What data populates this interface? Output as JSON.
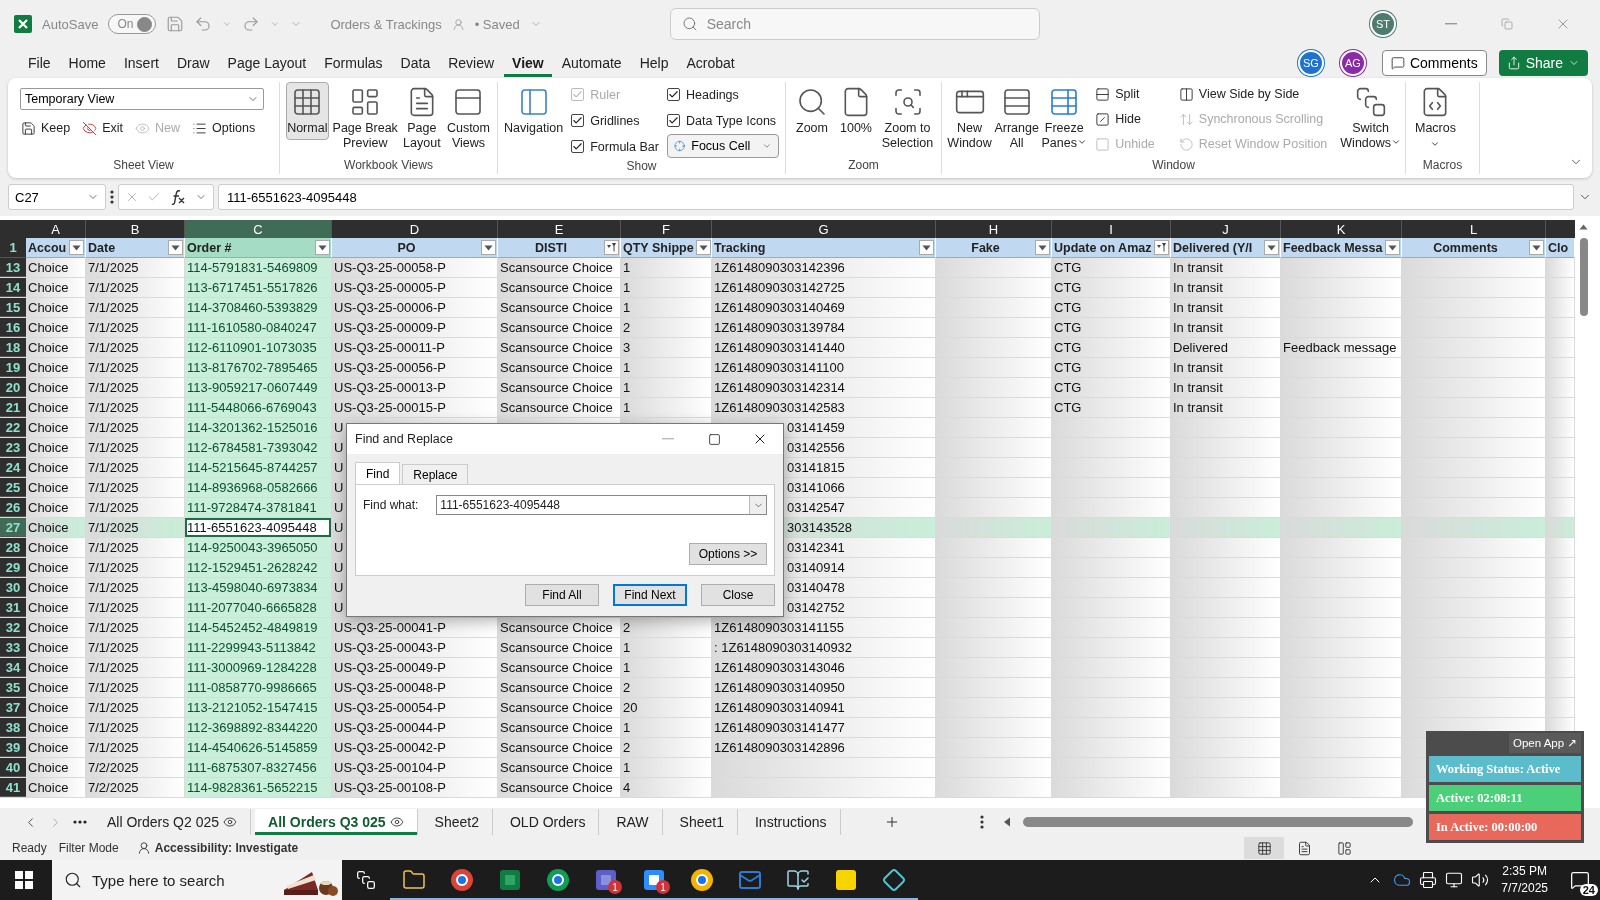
{
  "title_bar": {
    "autosave_label": "AutoSave",
    "autosave": {
      "on": true,
      "label": "On"
    },
    "document": "Orders & Trackings",
    "save_state": "• Saved",
    "search": {
      "placeholder": "Search"
    },
    "user": "ST"
  },
  "menu": {
    "tabs": [
      {
        "label": "File",
        "selected": false
      },
      {
        "label": "Home",
        "selected": false
      },
      {
        "label": "Insert",
        "selected": false
      },
      {
        "label": "Draw",
        "selected": false
      },
      {
        "label": "Page Layout",
        "selected": false
      },
      {
        "label": "Formulas",
        "selected": false
      },
      {
        "label": "Data",
        "selected": false
      },
      {
        "label": "Review",
        "selected": false
      },
      {
        "label": "View",
        "selected": true
      },
      {
        "label": "Automate",
        "selected": false
      },
      {
        "label": "Help",
        "selected": false
      },
      {
        "label": "Acrobat",
        "selected": false
      }
    ],
    "collaborators": [
      {
        "initials": "SG",
        "color": "#1e73d2"
      },
      {
        "initials": "AG",
        "color": "#8a2aa8"
      }
    ],
    "comments": "Comments",
    "share": "Share"
  },
  "ribbon": {
    "sheet_view": {
      "label": "Sheet View",
      "view": "Temporary View",
      "buttons": [
        {
          "label": "Keep",
          "disabled": false
        },
        {
          "label": "Exit",
          "disabled": false
        },
        {
          "label": "New",
          "disabled": true
        },
        {
          "label": "Options",
          "disabled": false
        }
      ]
    },
    "workbook_views": {
      "label": "Workbook Views",
      "items": [
        {
          "lines": [
            "Normal"
          ],
          "selected": true
        },
        {
          "lines": [
            "Page Break",
            "Preview"
          ],
          "selected": false
        },
        {
          "lines": [
            "Page",
            "Layout"
          ],
          "selected": false
        },
        {
          "lines": [
            "Custom",
            "Views"
          ],
          "selected": false
        }
      ]
    },
    "show": {
      "label": "Show",
      "navigation": "Navigation",
      "checks": [
        {
          "label": "Ruler",
          "checked": true,
          "disabled": true
        },
        {
          "label": "Gridlines",
          "checked": true,
          "disabled": false
        },
        {
          "label": "Formula Bar",
          "checked": true,
          "disabled": false
        },
        {
          "label": "Headings",
          "checked": true,
          "disabled": false
        },
        {
          "label": "Data Type Icons",
          "checked": true,
          "disabled": false
        }
      ],
      "focus_cell": "Focus Cell"
    },
    "zoom": {
      "label": "Zoom",
      "items": [
        {
          "lines": [
            "Zoom"
          ]
        },
        {
          "lines": [
            "100%"
          ]
        },
        {
          "lines": [
            "Zoom to",
            "Selection"
          ]
        }
      ]
    },
    "window": {
      "label": "Window",
      "large": [
        {
          "lines": [
            "New",
            "Window"
          ],
          "menu": false
        },
        {
          "lines": [
            "Arrange",
            "All"
          ],
          "menu": false
        },
        {
          "lines": [
            "Freeze",
            "Panes"
          ],
          "menu": true
        }
      ],
      "small": [
        {
          "label": "Split",
          "disabled": false
        },
        {
          "label": "Hide",
          "disabled": false
        },
        {
          "label": "Unhide",
          "disabled": true
        },
        {
          "label": "View Side by Side",
          "disabled": false
        },
        {
          "label": "Synchronous Scrolling",
          "disabled": true
        },
        {
          "label": "Reset Window Position",
          "disabled": true
        }
      ],
      "switch": {
        "lines": [
          "Switch",
          "Windows"
        ],
        "menu": true
      }
    },
    "macros": {
      "label": "Macros",
      "item": {
        "lines": [
          "Macros"
        ],
        "menu": true
      }
    }
  },
  "formula_bar": {
    "name_box": "C27",
    "value": "111-6551623-4095448"
  },
  "sheet": {
    "columns": [
      {
        "letter": "A",
        "selected": false
      },
      {
        "letter": "B",
        "selected": false
      },
      {
        "letter": "C",
        "selected": true
      },
      {
        "letter": "D",
        "selected": false
      },
      {
        "letter": "E",
        "selected": false
      },
      {
        "letter": "F",
        "selected": false
      },
      {
        "letter": "G",
        "selected": false
      },
      {
        "letter": "H",
        "selected": false
      },
      {
        "letter": "I",
        "selected": false
      },
      {
        "letter": "J",
        "selected": false
      },
      {
        "letter": "K",
        "selected": false
      },
      {
        "letter": "L",
        "selected": false
      }
    ],
    "header_row": "1",
    "headers": [
      {
        "label": "Accou",
        "filtered": false
      },
      {
        "label": "Date",
        "filtered": false
      },
      {
        "label": "Order #",
        "filtered": false
      },
      {
        "label": "PO",
        "filtered": false
      },
      {
        "label": "DISTI",
        "filtered": true
      },
      {
        "label": "QTY Shippe",
        "filtered": false
      },
      {
        "label": "Tracking",
        "filtered": false
      },
      {
        "label": "Fake",
        "filtered": false
      },
      {
        "label": "Update on Amaz",
        "filtered": true
      },
      {
        "label": "Delivered (Y/I",
        "filtered": false
      },
      {
        "label": "Feedback Messa",
        "filtered": false
      },
      {
        "label": "Comments",
        "filtered": false
      },
      {
        "label": "Clo"
      }
    ],
    "rows": [
      {
        "num": "13",
        "selected": false,
        "under_dialog": false,
        "cells": [
          "Choice",
          "7/1/2025",
          "114-5791831-5469809",
          "US-Q3-25-00058-P",
          "Scansource Choice",
          "1",
          "1Z6148090303142396",
          null,
          "CTG",
          "In transit"
        ]
      },
      {
        "num": "14",
        "selected": false,
        "under_dialog": false,
        "cells": [
          "Choice",
          "7/1/2025",
          "113-6717451-5517826",
          "US-Q3-25-00005-P",
          "Scansource Choice",
          "1",
          "1Z6148090303142725",
          null,
          "CTG",
          "In transit"
        ]
      },
      {
        "num": "15",
        "selected": false,
        "under_dialog": false,
        "cells": [
          "Choice",
          "7/1/2025",
          "114-3708460-5393829",
          "US-Q3-25-00006-P",
          "Scansource Choice",
          "1",
          "1Z6148090303140469",
          null,
          "CTG",
          "In transit"
        ]
      },
      {
        "num": "16",
        "selected": false,
        "under_dialog": false,
        "cells": [
          "Choice",
          "7/1/2025",
          "111-1610580-0840247",
          "US-Q3-25-00009-P",
          "Scansource Choice",
          "2",
          "1Z6148090303139784",
          null,
          "CTG",
          "In transit"
        ]
      },
      {
        "num": "18",
        "selected": false,
        "under_dialog": false,
        "cells": [
          "Choice",
          "7/1/2025",
          "112-6110901-1073035",
          "US-Q3-25-00011-P",
          "Scansource Choice",
          "3",
          "1Z6148090303141440",
          null,
          "CTG",
          "Delivered",
          "Feedback message"
        ]
      },
      {
        "num": "19",
        "selected": false,
        "under_dialog": false,
        "cells": [
          "Choice",
          "7/1/2025",
          "113-8176702-7895465",
          "US-Q3-25-00056-P",
          "Scansource Choice",
          "1",
          "1Z6148090303141100",
          null,
          "CTG",
          "In transit"
        ]
      },
      {
        "num": "20",
        "selected": false,
        "under_dialog": false,
        "cells": [
          "Choice",
          "7/1/2025",
          "113-9059217-0607449",
          "US-Q3-25-00013-P",
          "Scansource Choice",
          "1",
          "1Z6148090303142314",
          null,
          "CTG",
          "In transit"
        ]
      },
      {
        "num": "21",
        "selected": false,
        "under_dialog": false,
        "cells": [
          "Choice",
          "7/1/2025",
          "111-5448066-6769043",
          "US-Q3-25-00015-P",
          "Scansource Choice",
          "1",
          "1Z6148090303142583",
          null,
          "CTG",
          "In transit"
        ]
      },
      {
        "num": "22",
        "selected": false,
        "under_dialog": true,
        "cells": [
          "Choice",
          "7/1/2025",
          "114-3201362-1525016",
          "U",
          null,
          null,
          "03141459"
        ]
      },
      {
        "num": "23",
        "selected": false,
        "under_dialog": true,
        "cells": [
          "Choice",
          "7/1/2025",
          "112-6784581-7393042",
          "U",
          null,
          null,
          "03142556"
        ]
      },
      {
        "num": "24",
        "selected": false,
        "under_dialog": true,
        "cells": [
          "Choice",
          "7/1/2025",
          "114-5215645-8744257",
          "U",
          null,
          null,
          "03141815"
        ]
      },
      {
        "num": "25",
        "selected": false,
        "under_dialog": true,
        "cells": [
          "Choice",
          "7/1/2025",
          "114-8936968-0582666",
          "U",
          null,
          null,
          "03141066"
        ]
      },
      {
        "num": "26",
        "selected": false,
        "under_dialog": true,
        "cells": [
          "Choice",
          "7/1/2025",
          "111-9728474-3781841",
          "U",
          null,
          null,
          "03142547"
        ]
      },
      {
        "num": "27",
        "selected": true,
        "under_dialog": true,
        "cells": [
          "Choice",
          "7/1/2025",
          "111-6551623-4095448",
          "U",
          null,
          null,
          "303143528"
        ]
      },
      {
        "num": "28",
        "selected": false,
        "under_dialog": true,
        "cells": [
          "Choice",
          "7/1/2025",
          "114-9250043-3965050",
          "U",
          null,
          null,
          "03142341"
        ]
      },
      {
        "num": "29",
        "selected": false,
        "under_dialog": true,
        "cells": [
          "Choice",
          "7/1/2025",
          "112-1529451-2628242",
          "U",
          null,
          null,
          "03140914"
        ]
      },
      {
        "num": "30",
        "selected": false,
        "under_dialog": true,
        "cells": [
          "Choice",
          "7/1/2025",
          "113-4598040-6973834",
          "U",
          null,
          null,
          "03140478"
        ]
      },
      {
        "num": "31",
        "selected": false,
        "under_dialog": true,
        "cells": [
          "Choice",
          "7/1/2025",
          "111-2077040-6665828",
          "U",
          null,
          null,
          "03142752"
        ]
      },
      {
        "num": "32",
        "selected": false,
        "under_dialog": false,
        "cells": [
          "Choice",
          "7/1/2025",
          "114-5452452-4849819",
          "US-Q3-25-00041-P",
          "Scansource Choice",
          "2",
          "1Z6148090303141155"
        ]
      },
      {
        "num": "33",
        "selected": false,
        "under_dialog": false,
        "cells": [
          "Choice",
          "7/1/2025",
          "111-2299943-5113842",
          "US-Q3-25-00043-P",
          "Scansource Choice",
          "1",
          ": 1Z6148090303140932"
        ]
      },
      {
        "num": "34",
        "selected": false,
        "under_dialog": false,
        "cells": [
          "Choice",
          "7/1/2025",
          "111-3000969-1284228",
          "US-Q3-25-00049-P",
          "Scansource Choice",
          "1",
          "1Z6148090303143046"
        ]
      },
      {
        "num": "35",
        "selected": false,
        "under_dialog": false,
        "cells": [
          "Choice",
          "7/1/2025",
          "111-0858770-9986665",
          "US-Q3-25-00048-P",
          "Scansource Choice",
          "2",
          "1Z6148090303140950"
        ]
      },
      {
        "num": "37",
        "selected": false,
        "under_dialog": false,
        "cells": [
          "Choice",
          "7/1/2025",
          "113-2121052-1547415",
          "US-Q3-25-00054-P",
          "Scansource Choice",
          "20",
          "1Z6148090303140941"
        ]
      },
      {
        "num": "38",
        "selected": false,
        "under_dialog": false,
        "cells": [
          "Choice",
          "7/1/2025",
          "112-3698892-8344220",
          "US-Q3-25-00044-P",
          "Scansource Choice",
          "1",
          "1Z6148090303141477"
        ]
      },
      {
        "num": "39",
        "selected": false,
        "under_dialog": false,
        "cells": [
          "Choice",
          "7/1/2025",
          "114-4540626-5145859",
          "US-Q3-25-00042-P",
          "Scansource Choice",
          "2",
          "1Z6148090303142896"
        ]
      },
      {
        "num": "40",
        "selected": false,
        "under_dialog": false,
        "cells": [
          "Choice",
          "7/2/2025",
          "111-6875307-8327456",
          "US-Q3-25-00104-P",
          "Scansource Choice",
          "1"
        ]
      },
      {
        "num": "41",
        "selected": false,
        "under_dialog": false,
        "cells": [
          "Choice",
          "7/2/2025",
          "114-9828361-5652215",
          "US-Q3-25-00108-P",
          "Scansource Choice",
          "4"
        ]
      }
    ]
  },
  "dialog": {
    "title": "Find and Replace",
    "tabs": [
      {
        "label": "Find",
        "selected": true
      },
      {
        "label": "Replace",
        "selected": false
      }
    ],
    "find_label": "Find what:",
    "find_value": "111-6551623-4095448",
    "options": "Options >>",
    "buttons": [
      {
        "label": "Find All",
        "default": false
      },
      {
        "label": "Find Next",
        "default": true
      },
      {
        "label": "Close",
        "default": false
      }
    ]
  },
  "sheet_tabs": [
    {
      "label": "All Orders Q2 025",
      "selected": false,
      "eye": true
    },
    {
      "label": "All Orders Q3 025",
      "selected": true,
      "eye": true
    },
    {
      "label": "Sheet2",
      "selected": false,
      "eye": false
    },
    {
      "label": "OLD Orders",
      "selected": false,
      "eye": false
    },
    {
      "label": "RAW",
      "selected": false,
      "eye": false
    },
    {
      "label": "Sheet1",
      "selected": false,
      "eye": false
    },
    {
      "label": "Instructions",
      "selected": false,
      "eye": false
    }
  ],
  "status_bar": {
    "ready": "Ready",
    "filter_mode": "Filter Mode",
    "accessibility": "Accessibility: Investigate",
    "views": [
      {
        "selected": true
      },
      {
        "selected": false
      },
      {
        "selected": false
      }
    ]
  },
  "taskbar": {
    "search": {
      "placeholder": "Type here to search"
    },
    "apps": [
      {
        "running": true
      },
      {
        "running": true
      },
      {
        "running": true
      },
      {
        "running": true
      },
      {
        "running": true,
        "badge": "1"
      },
      {
        "running": true,
        "badge": "1"
      },
      {
        "running": true
      },
      {
        "running": true
      },
      {
        "running": true
      },
      {
        "running": true
      },
      {
        "running": true
      }
    ],
    "time": "2:35 PM",
    "date": "7/7/2025",
    "notifications": "24"
  },
  "tracker": {
    "open_app": "Open App ↗",
    "rows": [
      {
        "label": "Working Status: Active",
        "color": "#5bbdcc"
      },
      {
        "label": "Active: 02:08:11",
        "color": "#4bcf78"
      },
      {
        "label": "In Active: 00:00:00",
        "color": "#e8695c"
      }
    ]
  }
}
